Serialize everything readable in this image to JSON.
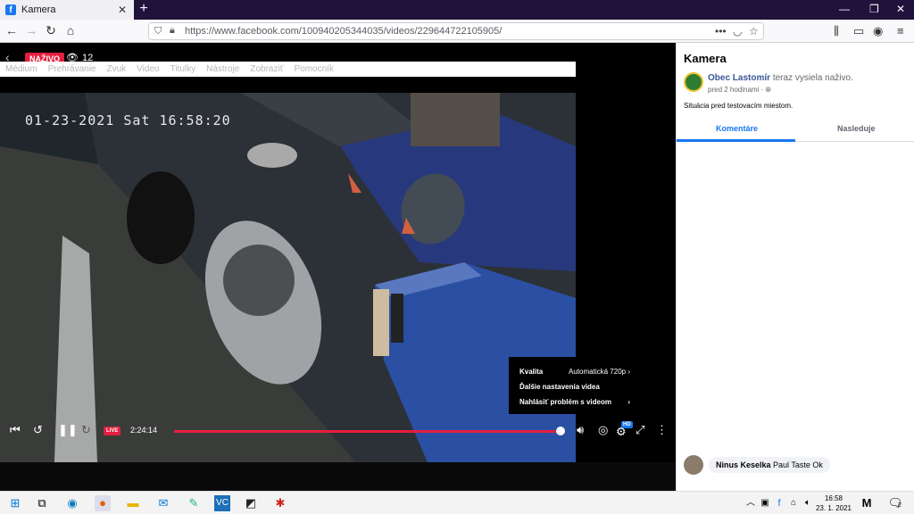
{
  "browser": {
    "tab_title": "Kamera",
    "url_domain": "https://www.facebook.com",
    "url_path": "/100940205344035/videos/229644722105905/"
  },
  "video": {
    "live_label": "NAŽIVO",
    "viewer_count": "12",
    "overlay_menu": [
      "Médium",
      "Prehrávanie",
      "Zvuk",
      "Video",
      "Titulky",
      "Nástroje",
      "Zobraziť",
      "Pomocník"
    ],
    "timestamp": "01-23-2021 Sat 16:58:20",
    "quality_menu": {
      "quality_label": "Kvalita",
      "quality_value": "Automatická 720p",
      "more_settings": "Ďalšie nastavenia videa",
      "report": "Nahlásiť problém s videom"
    },
    "controls": {
      "live_small": "LIVE",
      "elapsed": "2:24:14",
      "hd": "HD",
      "progress": 0.99
    }
  },
  "side": {
    "title": "Kamera",
    "author": "Obec Lastomír",
    "author_action": "teraz vysiela naživo.",
    "time": "pred 2 hodinami",
    "description": "Situácia pred testovacím miestom.",
    "tabs": [
      "Komentáre",
      "Nasleduje"
    ],
    "comment": {
      "name": "Ninus Keselka",
      "text": "Paul Taste Ok"
    }
  },
  "taskbar": {
    "time": "16:58",
    "date": "23. 1. 2021",
    "notification_count": "2"
  }
}
